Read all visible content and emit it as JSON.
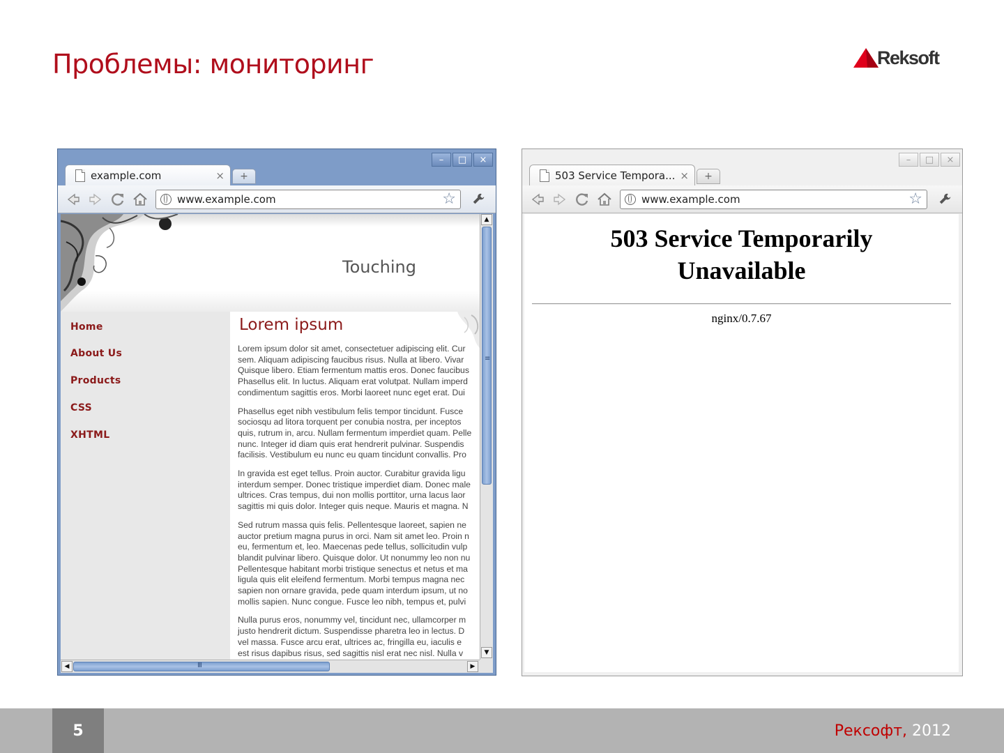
{
  "slide": {
    "title": "Проблемы: мониторинг",
    "brand": "Reksoft",
    "page_number": "5",
    "footer_company": "Рексофт,",
    "footer_year": " 2012",
    "colors": {
      "accent": "#b00e1c",
      "footer_bg": "#b3b3b3",
      "page_box": "#7f7f7f"
    }
  },
  "left_browser": {
    "tab_title": "example.com",
    "tab_close": "×",
    "new_tab": "+",
    "url": "www.example.com",
    "window_controls": [
      "–",
      "□",
      "×"
    ],
    "toolbar_icons": [
      "back-icon",
      "forward-icon",
      "reload-icon",
      "home-icon",
      "star-icon",
      "wrench-icon"
    ],
    "page": {
      "banner_title": "Touching",
      "nav": [
        "Home",
        "About Us",
        "Products",
        "CSS",
        "XHTML"
      ],
      "heading": "Lorem ipsum",
      "paragraphs": [
        [
          "Lorem ipsum dolor sit amet, consectetuer adipiscing elit. Cur",
          "sem. Aliquam adipiscing faucibus risus. Nulla at libero. Vivar",
          "Quisque libero. Etiam fermentum mattis eros. Donec faucibus",
          "Phasellus elit. In luctus. Aliquam erat volutpat. Nullam imperd",
          "condimentum sagittis eros. Morbi laoreet nunc eget erat. Dui"
        ],
        [
          "Phasellus eget nibh vestibulum felis tempor tincidunt. Fusce",
          "sociosqu ad litora torquent per conubia nostra, per inceptos",
          "quis, rutrum in, arcu. Nullam fermentum imperdiet quam. Pelle",
          "nunc. Integer id diam quis erat hendrerit pulvinar. Suspendis",
          "facilisis. Vestibulum eu nunc eu quam tincidunt convallis. Pro"
        ],
        [
          "In gravida est eget tellus. Proin auctor. Curabitur gravida ligu",
          "interdum semper. Donec tristique imperdiet diam. Donec male",
          "ultrices. Cras tempus, dui non mollis porttitor, urna lacus laor",
          "sagittis mi quis dolor. Integer quis neque. Mauris et magna. N"
        ],
        [
          "Sed rutrum massa quis felis. Pellentesque laoreet, sapien ne",
          "auctor pretium magna purus in orci. Nam sit amet leo. Proin n",
          "eu, fermentum et, leo. Maecenas pede tellus, sollicitudin vulp",
          "blandit pulvinar libero. Quisque dolor. Ut nonummy leo non nu",
          "Pellentesque habitant morbi tristique senectus et netus et ma",
          "ligula quis elit eleifend fermentum. Morbi tempus magna nec",
          "sapien non ornare gravida, pede quam interdum ipsum, ut no",
          "mollis sapien. Nunc congue. Fusce leo nibh, tempus et, pulvi"
        ],
        [
          "Nulla purus eros, nonummy vel, tincidunt nec, ullamcorper m",
          "justo hendrerit dictum. Suspendisse pharetra leo in lectus. D",
          "vel massa. Fusce arcu erat, ultrices ac, fringilla eu, iaculis e",
          "est risus dapibus risus, sed sagittis nisl erat nec nisl. Nulla v"
        ]
      ]
    },
    "scrollbar_grip": "≡",
    "hscroll_grip": "III"
  },
  "right_browser": {
    "tab_title": "503 Service Tempora...",
    "tab_close": "×",
    "new_tab": "+",
    "url": "www.example.com",
    "window_controls": [
      "–",
      "□",
      "×"
    ],
    "page": {
      "error_title_line1": "503 Service Temporarily",
      "error_title_line2": "Unavailable",
      "server": "nginx/0.7.67"
    }
  }
}
